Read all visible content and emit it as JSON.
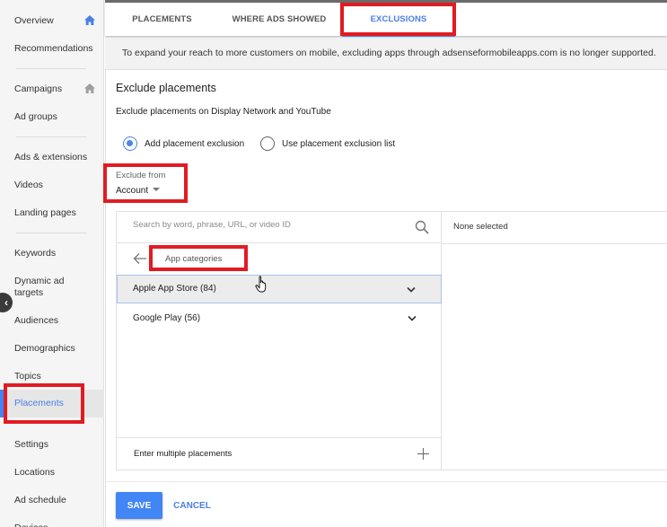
{
  "sidebar": {
    "items": [
      {
        "label": "Overview",
        "icon": "home-icon",
        "icon_color": "#4a7fe8"
      },
      {
        "label": "Recommendations"
      },
      {
        "label": "Campaigns",
        "icon": "home-icon",
        "icon_color": "#9e9e9e"
      },
      {
        "label": "Ad groups"
      },
      {
        "label": "Ads & extensions"
      },
      {
        "label": "Videos"
      },
      {
        "label": "Landing pages"
      },
      {
        "label": "Keywords"
      },
      {
        "label": "Dynamic ad targets"
      },
      {
        "label": "Audiences"
      },
      {
        "label": "Demographics"
      },
      {
        "label": "Topics"
      },
      {
        "label": "Placements",
        "active": true
      },
      {
        "label": "Settings"
      },
      {
        "label": "Locations"
      },
      {
        "label": "Ad schedule"
      },
      {
        "label": "Devices"
      }
    ],
    "collapse_icon": "chevron-left-icon"
  },
  "tabs": [
    {
      "label": "PLACEMENTS"
    },
    {
      "label": "WHERE ADS SHOWED"
    },
    {
      "label": "EXCLUSIONS",
      "active": true
    }
  ],
  "notice": "To expand your reach to more customers on mobile, excluding apps through adsenseformobileapps.com is no longer supported.",
  "form": {
    "title": "Exclude placements",
    "subtitle": "Exclude placements on Display Network and YouTube",
    "radio_options": [
      {
        "label": "Add placement exclusion",
        "checked": true
      },
      {
        "label": "Use placement exclusion list",
        "checked": false
      }
    ],
    "exclude_from": {
      "label": "Exclude from",
      "value": "Account"
    }
  },
  "picker": {
    "search_placeholder": "Search by word, phrase, URL, or video ID",
    "search_value": "",
    "breadcrumb": "App categories",
    "items": [
      {
        "label": "Apple App Store (84)",
        "hovered": true
      },
      {
        "label": "Google Play (56)"
      }
    ],
    "enter_multiple": "Enter multiple placements",
    "selected_summary": "None selected"
  },
  "actions": {
    "save": "SAVE",
    "cancel": "CANCEL"
  },
  "colors": {
    "accent": "#4285f4",
    "accent_text": "#4a7fe8",
    "annotation": "#e21b23"
  }
}
